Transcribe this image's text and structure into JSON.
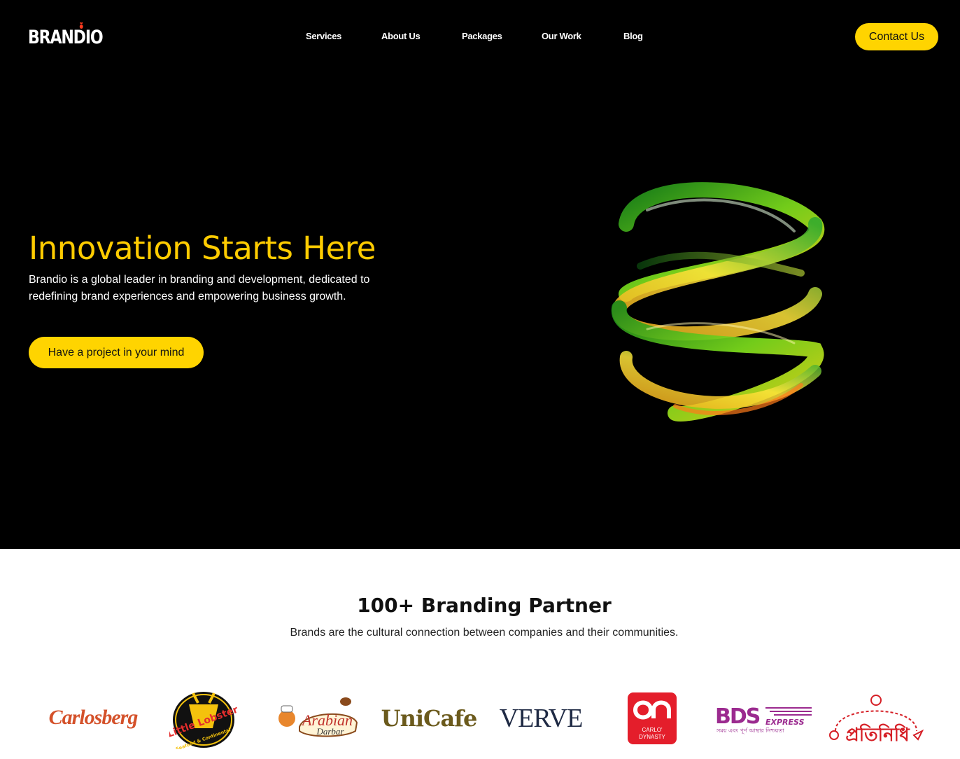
{
  "header": {
    "logo_text": "BRANDIO",
    "nav": [
      "Services",
      "About Us",
      "Packages",
      "Our Work",
      "Blog"
    ],
    "contact_label": "Contact Us"
  },
  "hero": {
    "title": "Innovation Starts Here",
    "description": "Brandio is a global leader in branding and development, dedicated to redefining brand experiences and empowering business growth.",
    "cta_label": "Have a project in your mind"
  },
  "partners": {
    "title": "100+ Branding Partner",
    "subtitle": "Brands are the cultural connection between companies and their communities.",
    "logos": {
      "carlosberg": "Carlosberg",
      "little_lobster_1": "Little Lobster",
      "little_lobster_2": "Seafood & Continental",
      "arabian_darbar_1": "Arabian",
      "arabian_darbar_2": "Darbar",
      "unicafe": "UniCafe",
      "verve": "VERVE",
      "carlo_1": "CARLO'",
      "carlo_2": "DYNASTY",
      "bds_1": "BDS",
      "bds_2": "EXPRESS",
      "bds_3": "সময় এবং পূর্ণ আস্থার নিশ্চয়তা",
      "protinidhi": "প্রতিনিধি"
    }
  },
  "colors": {
    "accent": "#ffd400",
    "hero_title": "#ffcc00",
    "hero_bg": "#000000"
  }
}
